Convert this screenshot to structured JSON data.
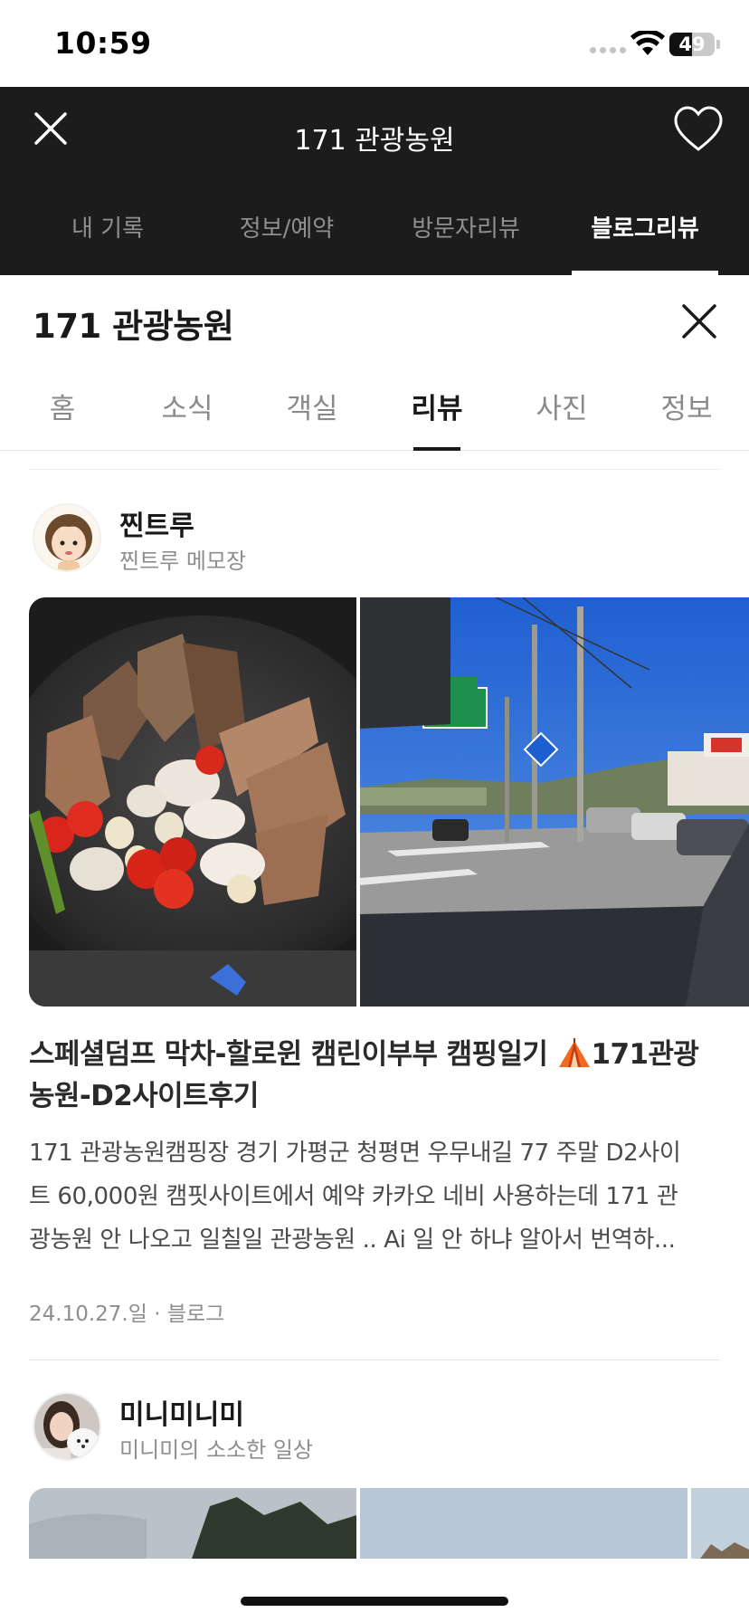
{
  "status_bar": {
    "time": "10:59",
    "battery": "49",
    "battery_level": 0.49
  },
  "header": {
    "title": "171 관광농원",
    "tabs": [
      {
        "label": "내 기록",
        "active": false
      },
      {
        "label": "정보/예약",
        "active": false
      },
      {
        "label": "방문자리뷰",
        "active": false
      },
      {
        "label": "블로그리뷰",
        "active": true
      }
    ]
  },
  "place": {
    "title": "171 관광농원",
    "tabs": [
      {
        "label": "홈",
        "active": false
      },
      {
        "label": "소식",
        "active": false
      },
      {
        "label": "객실",
        "active": false
      },
      {
        "label": "리뷰",
        "active": true
      },
      {
        "label": "사진",
        "active": false
      },
      {
        "label": "정보",
        "active": false
      }
    ]
  },
  "reviews": [
    {
      "author": "찐트루",
      "blog": "찐트루 메모장",
      "title": "스페셜덤프 막차-할로윈 캠린이부부 캠핑일기 ⛺171관광농원-D2사이트후기",
      "title_line1": "스페셜덤프 막차-할로윈 캠린이부부 캠핑일기",
      "title_line1_tail": "171관광",
      "title_line2": "농원-D2사이트후기",
      "body": "171 관광농원캠핑장 경기 가평군 청평면 우무내길 77 주말 D2사이트 60,000원 캠핏사이트에서 예약 카카오 네비 사용하는데 171 관광농원 안 나오고 일칠일 관광농원 .. Ai 일 안 하냐 알아서 번역하...",
      "body_line1": "171 관광농원캠핑장 경기 가평군 청평면 우무내길 77 주말 D2사이",
      "body_line2": "트 60,000원 캠핏사이트에서 예약 카카오 네비 사용하는데 171 관",
      "body_line3": "광농원 안 나오고 일칠일 관광농원 .. Ai 일 안 하냐 알아서 번역하...",
      "date": "24.10.27.일",
      "source": "블로그",
      "date_source": "24.10.27.일 · 블로그"
    },
    {
      "author": "미니미니미",
      "blog": "미니미의 소소한 일상"
    }
  ],
  "colors": {
    "header_bg": "#1c1c1c",
    "active_text": "#1a1a1a",
    "muted_text": "#8e8e8e"
  }
}
